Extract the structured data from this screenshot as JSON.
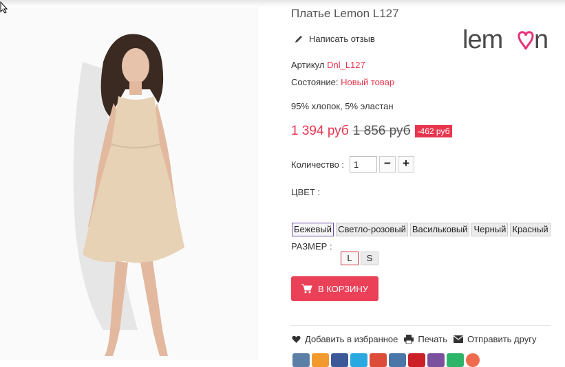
{
  "product": {
    "title": "Платье Lemon L127",
    "review_link": "Написать отзыв",
    "brand_logo_text": "lemon",
    "article_label": "Артикул",
    "article_value": "Dnl_L127",
    "condition_label": "Состояние:",
    "condition_value": "Новый товар",
    "material": "95% хлопок, 5% эластан"
  },
  "price": {
    "current": "1 394 руб",
    "old": "1 856 руб",
    "discount": "-462 руб"
  },
  "quantity": {
    "label": "Количество :",
    "value": "1",
    "minus": "−",
    "plus": "+"
  },
  "color": {
    "label": "ЦВЕТ :",
    "options": [
      "Бежевый",
      "Светло-розовый",
      "Васильковый",
      "Черный",
      "Красный"
    ],
    "selected": "Бежевый"
  },
  "size": {
    "label": "РАЗМЕР :",
    "options": [
      "L",
      "S"
    ],
    "selected": "L"
  },
  "cart_button": "В КОРЗИНУ",
  "actions": {
    "wishlist": "Добавить в избранное",
    "print": "Печать",
    "send": "Отправить другу"
  },
  "colors": {
    "accent": "#e8364f",
    "cart": "#ea4158",
    "logo": "#4a4a4a",
    "heart": "#e8307a"
  },
  "social_colors": [
    "#5b7fa6",
    "#f29a2e",
    "#3b5998",
    "#29a9e1",
    "#dd4b39",
    "#4a76a8",
    "#cb2027",
    "#7b519d",
    "#2fb56a",
    "#ee6b4d"
  ]
}
